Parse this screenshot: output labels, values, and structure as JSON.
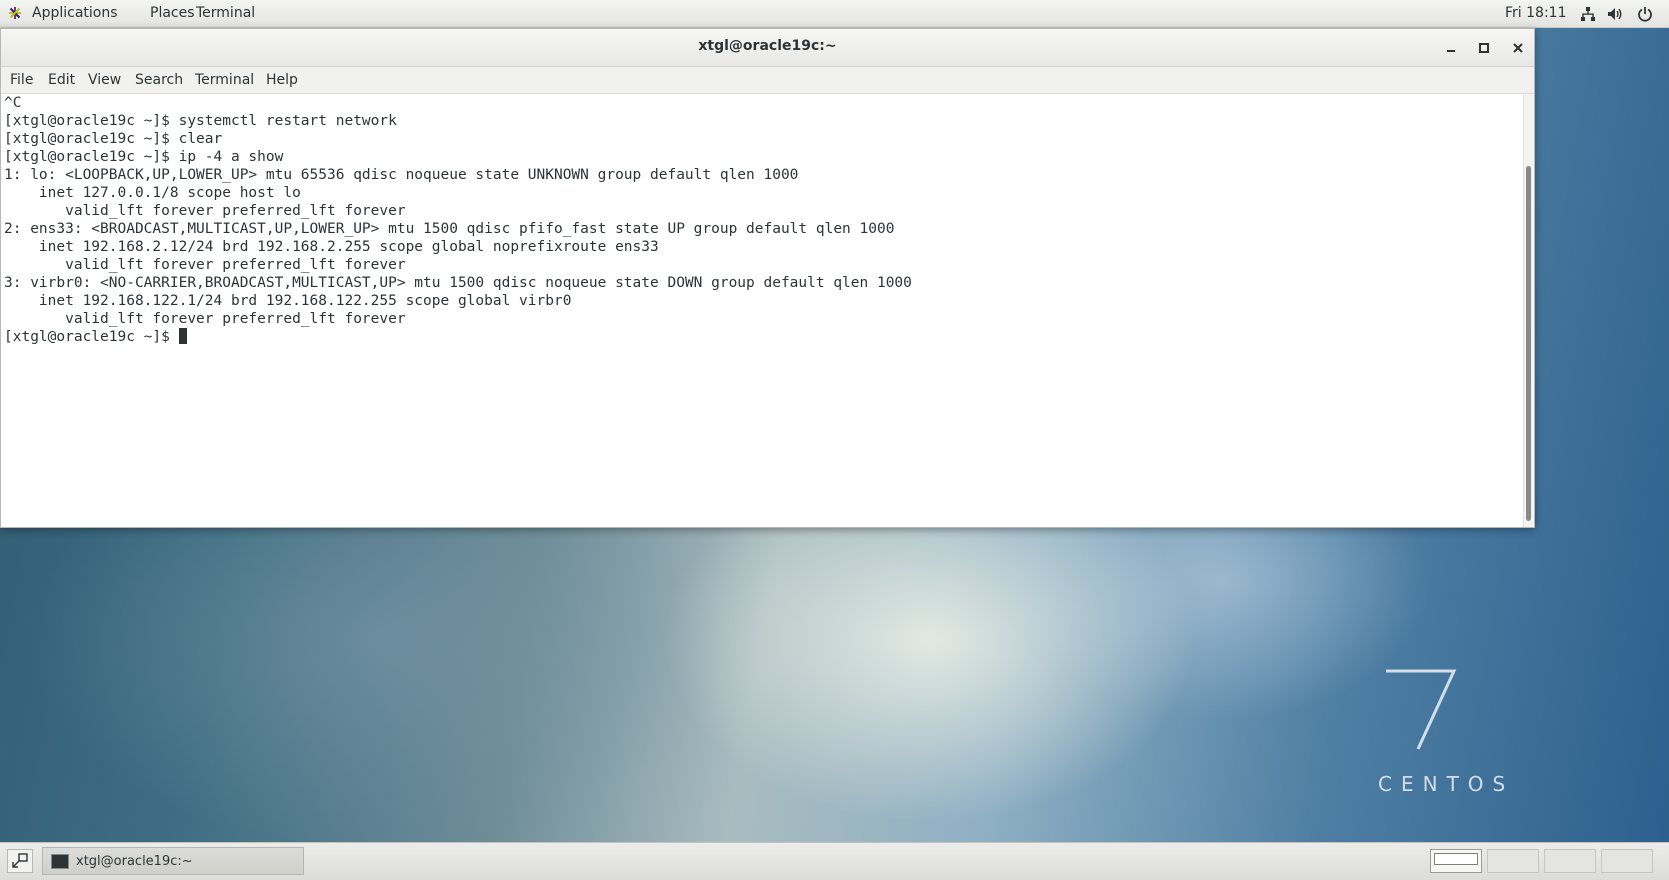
{
  "topbar": {
    "menus": [
      "Applications",
      "Places",
      "Terminal"
    ],
    "clock": "Fri 18:11",
    "system_icons": [
      "network-icon",
      "volume-icon",
      "power-icon"
    ]
  },
  "window": {
    "title": "xtgl@oracle19c:~",
    "controls": [
      "minimize-icon",
      "maximize-icon",
      "close-icon"
    ],
    "menu": [
      "File",
      "Edit",
      "View",
      "Search",
      "Terminal",
      "Help"
    ]
  },
  "terminal": {
    "lines": [
      "^C",
      "[xtgl@oracle19c ~]$ systemctl restart network",
      "[xtgl@oracle19c ~]$ clear",
      "[xtgl@oracle19c ~]$ ip -4 a show",
      "1: lo: <LOOPBACK,UP,LOWER_UP> mtu 65536 qdisc noqueue state UNKNOWN group default qlen 1000",
      "    inet 127.0.0.1/8 scope host lo",
      "       valid_lft forever preferred_lft forever",
      "2: ens33: <BROADCAST,MULTICAST,UP,LOWER_UP> mtu 1500 qdisc pfifo_fast state UP group default qlen 1000",
      "    inet 192.168.2.12/24 brd 192.168.2.255 scope global noprefixroute ens33",
      "       valid_lft forever preferred_lft forever",
      "3: virbr0: <NO-CARRIER,BROADCAST,MULTICAST,UP> mtu 1500 qdisc noqueue state DOWN group default qlen 1000",
      "    inet 192.168.122.1/24 brd 192.168.122.255 scope global virbr0",
      "       valid_lft forever preferred_lft forever"
    ],
    "prompt": "[xtgl@oracle19c ~]$ "
  },
  "desktop": {
    "logo_number": "7",
    "logo_text": "CENTOS"
  },
  "taskbar": {
    "task_label": "xtgl@oracle19c:~",
    "workspaces": 4,
    "active_workspace": 1
  },
  "colors": {
    "terminal_text": "#2e3436",
    "terminal_bg": "#ffffff"
  }
}
